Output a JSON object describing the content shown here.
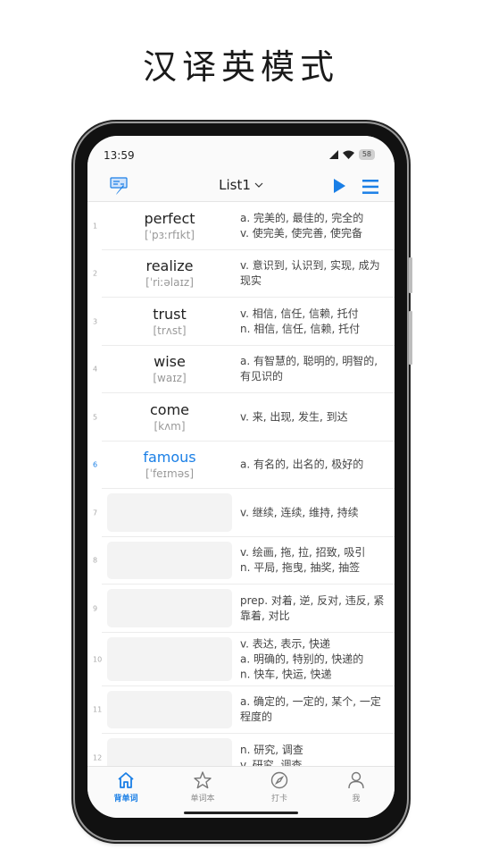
{
  "heading": "汉译英模式",
  "status_bar": {
    "time": "13:59",
    "battery": "58"
  },
  "app_bar": {
    "list_name": "List1"
  },
  "colors": {
    "accent": "#1a7fe6",
    "text": "#222222",
    "muted": "#999999",
    "blank": "#f3f3f3"
  },
  "words": [
    {
      "num": "1",
      "word": "perfect",
      "phonetic": "[ˈpɜːrfɪkt]",
      "definition": [
        "a. 完美的, 最佳的, 完全的",
        "v. 使完美, 使完善, 使完备"
      ],
      "revealed": true,
      "active": false
    },
    {
      "num": "2",
      "word": "realize",
      "phonetic": "[ˈriːəlaɪz]",
      "definition": [
        "v. 意识到, 认识到, 实现, 成为现实"
      ],
      "revealed": true,
      "active": false
    },
    {
      "num": "3",
      "word": "trust",
      "phonetic": "[trʌst]",
      "definition": [
        "v. 相信, 信任, 信赖, 托付",
        "n. 相信, 信任, 信赖, 托付"
      ],
      "revealed": true,
      "active": false
    },
    {
      "num": "4",
      "word": "wise",
      "phonetic": "[waɪz]",
      "definition": [
        "a. 有智慧的, 聪明的, 明智的, 有见识的"
      ],
      "revealed": true,
      "active": false
    },
    {
      "num": "5",
      "word": "come",
      "phonetic": "[kʌm]",
      "definition": [
        "v. 来, 出现, 发生, 到达"
      ],
      "revealed": true,
      "active": false
    },
    {
      "num": "6",
      "word": "famous",
      "phonetic": "[ˈfeɪməs]",
      "definition": [
        "a. 有名的, 出名的, 极好的"
      ],
      "revealed": true,
      "active": true
    },
    {
      "num": "7",
      "word": "",
      "phonetic": "",
      "definition": [
        "v. 继续, 连续, 维持, 持续"
      ],
      "revealed": false,
      "active": false
    },
    {
      "num": "8",
      "word": "",
      "phonetic": "",
      "definition": [
        "v. 绘画, 拖, 拉, 招致, 吸引",
        "n. 平局, 拖曳, 抽奖, 抽签"
      ],
      "revealed": false,
      "active": false
    },
    {
      "num": "9",
      "word": "",
      "phonetic": "",
      "definition": [
        "prep. 对着, 逆, 反对, 违反, 紧靠着, 对比"
      ],
      "revealed": false,
      "active": false
    },
    {
      "num": "10",
      "word": "",
      "phonetic": "",
      "definition": [
        "v. 表达, 表示, 快递",
        "a. 明确的, 特别的, 快递的",
        "n. 快车, 快运, 快递"
      ],
      "revealed": false,
      "active": false
    },
    {
      "num": "11",
      "word": "",
      "phonetic": "",
      "definition": [
        "a. 确定的, 一定的, 某个, 一定程度的"
      ],
      "revealed": false,
      "active": false
    },
    {
      "num": "12",
      "word": "",
      "phonetic": "",
      "definition": [
        "n. 研究, 调查",
        "v. 研究, 调查"
      ],
      "revealed": false,
      "active": false
    }
  ],
  "tabs": [
    {
      "label": "背单词",
      "icon": "home-icon",
      "active": true
    },
    {
      "label": "单词本",
      "icon": "star-icon",
      "active": false
    },
    {
      "label": "打卡",
      "icon": "compass-icon",
      "active": false
    },
    {
      "label": "我",
      "icon": "person-icon",
      "active": false
    }
  ]
}
